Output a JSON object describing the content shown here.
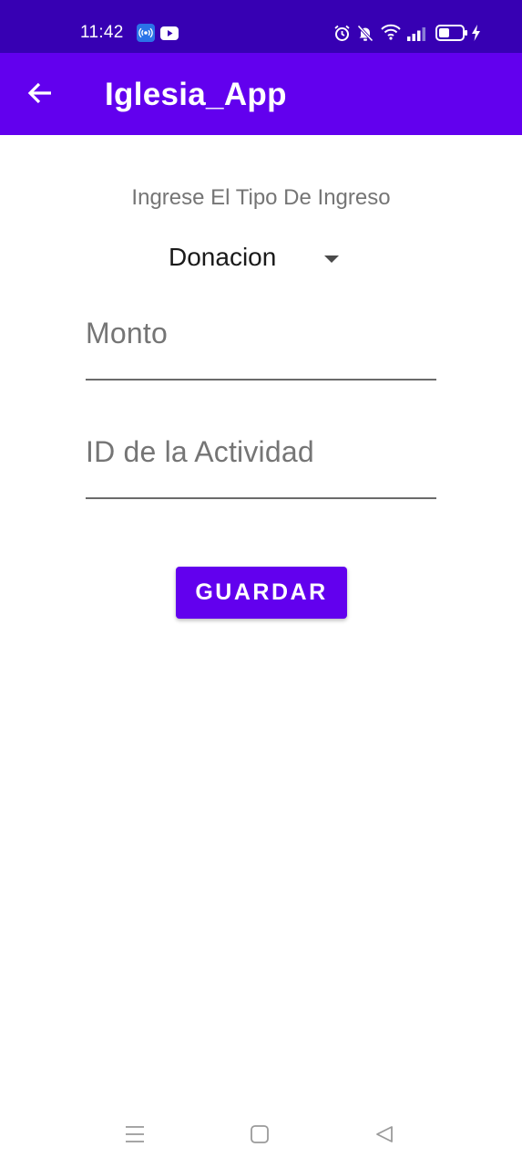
{
  "status_bar": {
    "time": "11:42",
    "left_icons": [
      "radio-broadcast-icon",
      "youtube-icon"
    ],
    "right_icons": [
      "alarm-icon",
      "notifications-off-icon",
      "wifi-icon",
      "signal-icon",
      "battery-icon",
      "charging-icon"
    ]
  },
  "app_bar": {
    "title": "Iglesia_App",
    "back_icon": "arrow-back-icon"
  },
  "form": {
    "type_label": "Ingrese El Tipo De Ingreso",
    "type_selected": "Donacion",
    "monto_placeholder": "Monto",
    "actividad_placeholder": "ID de la Actividad",
    "save_label": "GUARDAR"
  },
  "nav_bar": {
    "icons": [
      "menu-icon",
      "home-icon",
      "back-triangle-icon"
    ]
  },
  "colors": {
    "status_bar": "#3700b3",
    "primary": "#6200ee",
    "hint_text": "#757575",
    "background": "#ffffff"
  }
}
